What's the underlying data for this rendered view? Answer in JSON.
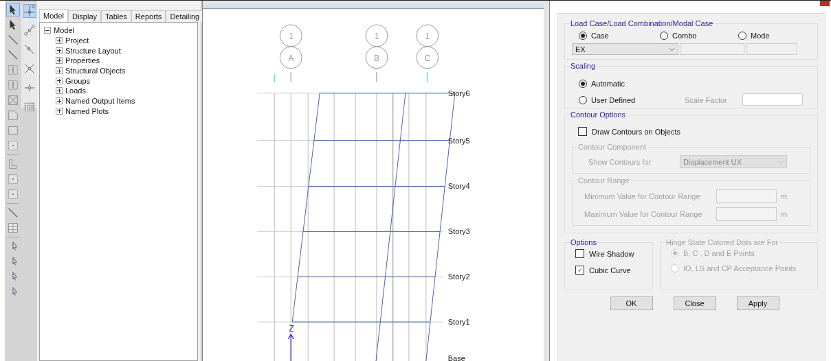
{
  "tabs": [
    {
      "label": "Model",
      "selected": true
    },
    {
      "label": "Display",
      "selected": false
    },
    {
      "label": "Tables",
      "selected": false
    },
    {
      "label": "Reports",
      "selected": false
    },
    {
      "label": "Detailing",
      "selected": false
    }
  ],
  "tree": {
    "label": "Model",
    "expanded": true,
    "children": [
      {
        "label": "Project",
        "expanded": false
      },
      {
        "label": "Structure Layout",
        "expanded": false
      },
      {
        "label": "Properties",
        "expanded": false
      },
      {
        "label": "Structural Objects",
        "expanded": false
      },
      {
        "label": "Groups",
        "expanded": false
      },
      {
        "label": "Loads",
        "expanded": false
      },
      {
        "label": "Named Output Items",
        "expanded": false
      },
      {
        "label": "Named Plots",
        "expanded": false
      }
    ]
  },
  "canvas": {
    "grid_bubbles": [
      {
        "number": "1",
        "letter": "A"
      },
      {
        "number": "1",
        "letter": "B"
      },
      {
        "number": "1",
        "letter": "C"
      }
    ],
    "stories": [
      "Story6",
      "Story5",
      "Story4",
      "Story3",
      "Story2",
      "Story1",
      "Base"
    ],
    "axis_label": "Z"
  },
  "dialog": {
    "load_case": {
      "title": "Load Case/Load Combination/Modal Case",
      "options": [
        {
          "label": "Case",
          "selected": true
        },
        {
          "label": "Combo",
          "selected": false
        },
        {
          "label": "Mode",
          "selected": false
        }
      ],
      "value": "EX"
    },
    "scaling": {
      "title": "Scaling",
      "options": [
        {
          "label": "Automatic",
          "selected": true
        },
        {
          "label": "User Defined",
          "selected": false
        }
      ],
      "scale_factor_label": "Scale Factor"
    },
    "contour_options": {
      "title": "Contour Options",
      "draw_contours": {
        "label": "Draw Contours on Objects",
        "checked": false
      },
      "component": {
        "title": "Contour Component",
        "label": "Show Contours for",
        "value": "Displacement UX",
        "disabled": true
      },
      "range": {
        "title": "Contour Range",
        "disabled": true,
        "rows": [
          {
            "label": "Minimum Value for Contour Range",
            "unit": "m"
          },
          {
            "label": "Maximum Value for Contour Range",
            "unit": "m"
          }
        ]
      }
    },
    "options": {
      "title": "Options",
      "items": [
        {
          "label": "Wire Shadow",
          "checked": false
        },
        {
          "label": "Cubic Curve",
          "checked": true
        }
      ]
    },
    "hinge": {
      "title": "Hinge State Colored Dots are For",
      "disabled": true,
      "options": [
        {
          "label": "B, C , D and E Points",
          "selected": true
        },
        {
          "label": "IO, LS and CP Acceptance Points",
          "selected": false
        }
      ]
    },
    "buttons": [
      "OK",
      "Close",
      "Apply"
    ]
  }
}
